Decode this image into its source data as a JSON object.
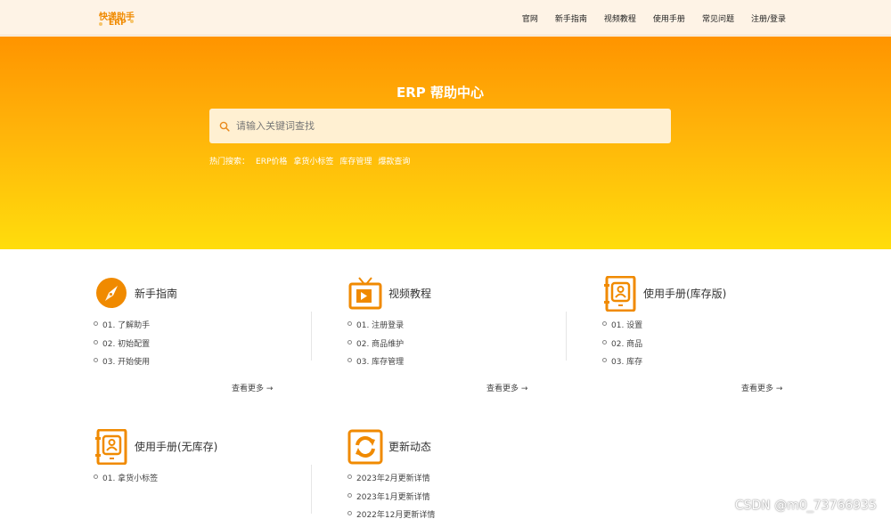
{
  "header": {
    "logo": {
      "line1": "快递助手",
      "line2": "ERP"
    },
    "nav": [
      "官网",
      "新手指南",
      "视频教程",
      "使用手册",
      "常见问题",
      "注册/登录"
    ]
  },
  "hero": {
    "title": "ERP 帮助中心",
    "search_placeholder": "请输入关键词查找",
    "hot_label": "热门搜索：",
    "hot_terms": [
      "ERP价格",
      "拿货小标签",
      "库存管理",
      "爆款查询"
    ]
  },
  "sections": [
    {
      "title": "新手指南",
      "icon": "compass-icon",
      "items": [
        "01. 了解助手",
        "02. 初始配置",
        "03. 开始使用"
      ],
      "more": "查看更多 →"
    },
    {
      "title": "视频教程",
      "icon": "tv-play-icon",
      "items": [
        "01. 注册登录",
        "02. 商品维护",
        "03. 库存管理"
      ],
      "more": "查看更多 →"
    },
    {
      "title": "使用手册(库存版)",
      "icon": "manual-icon",
      "items": [
        "01. 设置",
        "02. 商品",
        "03. 库存"
      ],
      "more": "查看更多 →"
    },
    {
      "title": "使用手册(无库存)",
      "icon": "manual-icon",
      "items": [
        "01. 拿货小标签"
      ],
      "more": ""
    },
    {
      "title": "更新动态",
      "icon": "refresh-icon",
      "items": [
        "2023年2月更新详情",
        "2023年1月更新详情",
        "2022年12月更新详情"
      ],
      "more": ""
    }
  ],
  "watermark": "CSDN @m0_73766935",
  "colors": {
    "accent": "#f08a00",
    "hero_top": "#ff9400",
    "hero_bottom": "#ffdd0c"
  }
}
